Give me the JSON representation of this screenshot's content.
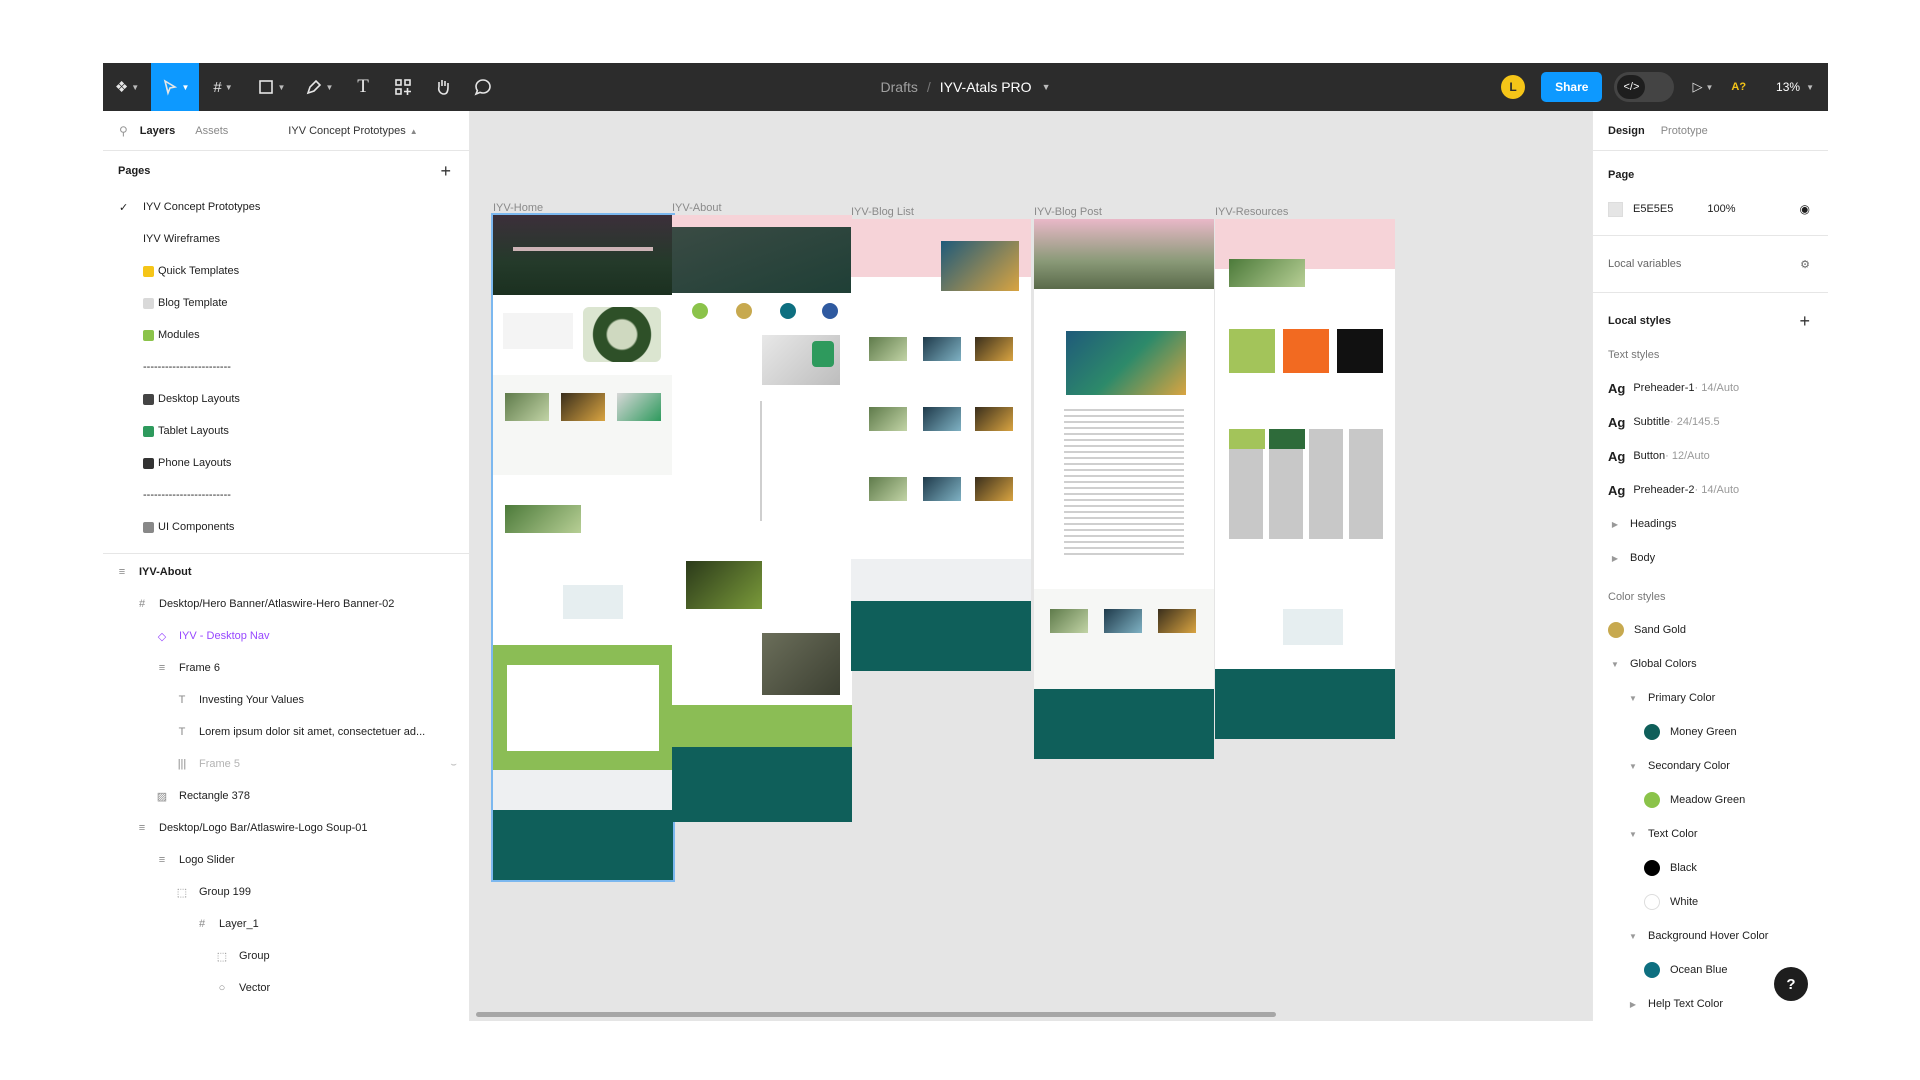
{
  "toolbar": {
    "breadcrumb_drafts": "Drafts",
    "breadcrumb_sep": "/",
    "file_name": "IYV-Atals PRO",
    "avatar_letter": "L",
    "share_label": "Share",
    "dev_mode_label": "</>",
    "ai_badge": "A?",
    "zoom": "13%"
  },
  "left_panel": {
    "tabs": [
      "Layers",
      "Assets"
    ],
    "page_picker": "IYV Concept Prototypes",
    "pages_heading": "Pages",
    "pages": [
      {
        "label": "IYV Concept Prototypes",
        "current": true,
        "icon": "check"
      },
      {
        "label": "IYV Wireframes",
        "icon": ""
      },
      {
        "label": "Quick Templates",
        "icon": "lightning"
      },
      {
        "label": "Blog Template",
        "icon": "page"
      },
      {
        "label": "Modules",
        "icon": "green-square"
      },
      {
        "label": "------------------------",
        "icon": ""
      },
      {
        "label": "Desktop Layouts",
        "icon": "monitor"
      },
      {
        "label": "Tablet Layouts",
        "icon": "tablet"
      },
      {
        "label": "Phone Layouts",
        "icon": "phone"
      },
      {
        "label": "------------------------",
        "icon": ""
      },
      {
        "label": "UI Components",
        "icon": "gear"
      }
    ],
    "layers": [
      {
        "label": "IYV-About",
        "icon": "≡",
        "indent": 0,
        "style": "bold"
      },
      {
        "label": "Desktop/Hero Banner/Atlaswire-Hero Banner-02",
        "icon": "#",
        "indent": 1,
        "style": ""
      },
      {
        "label": "IYV - Desktop Nav",
        "icon": "◇",
        "indent": 2,
        "style": "purple"
      },
      {
        "label": "Frame 6",
        "icon": "≡",
        "indent": 2,
        "style": ""
      },
      {
        "label": "Investing Your Values",
        "icon": "T",
        "indent": 3,
        "style": ""
      },
      {
        "label": "Lorem ipsum dolor sit amet, consectetuer ad...",
        "icon": "T",
        "indent": 3,
        "style": ""
      },
      {
        "label": "Frame 5",
        "icon": "|||",
        "indent": 3,
        "style": "dim"
      },
      {
        "label": "Rectangle 378",
        "icon": "▨",
        "indent": 2,
        "style": ""
      },
      {
        "label": "Desktop/Logo Bar/Atlaswire-Logo Soup-01",
        "icon": "≡",
        "indent": 1,
        "style": ""
      },
      {
        "label": "Logo Slider",
        "icon": "≡",
        "indent": 2,
        "style": ""
      },
      {
        "label": "Group 199",
        "icon": "⬚",
        "indent": 3,
        "style": ""
      },
      {
        "label": "Layer_1",
        "icon": "#",
        "indent": 4,
        "style": ""
      },
      {
        "label": "Group",
        "icon": "⬚",
        "indent": 5,
        "style": ""
      },
      {
        "label": "Vector",
        "icon": "○",
        "indent": 5,
        "style": ""
      }
    ]
  },
  "canvas": {
    "frames": [
      {
        "label": "IYV-Home",
        "selected": true
      },
      {
        "label": "IYV-About",
        "selected": false
      },
      {
        "label": "IYV-Blog List",
        "selected": false
      },
      {
        "label": "IYV-Blog Post",
        "selected": false
      },
      {
        "label": "IYV-Resources",
        "selected": false
      }
    ],
    "background": "#e5e5e5"
  },
  "right_panel": {
    "tabs": [
      "Design",
      "Prototype"
    ],
    "page_heading": "Page",
    "page_color": "E5E5E5",
    "page_opacity": "100%",
    "local_variables": "Local variables",
    "local_styles": "Local styles",
    "text_styles_heading": "Text styles",
    "text_styles": [
      {
        "name": "Preheader-1",
        "meta": " · 14/Auto"
      },
      {
        "name": "Subtitle",
        "meta": " · 24/145.5"
      },
      {
        "name": "Button",
        "meta": " · 12/Auto"
      },
      {
        "name": "Preheader-2",
        "meta": " · 14/Auto"
      }
    ],
    "text_groups": [
      "Headings",
      "Body"
    ],
    "color_styles_heading": "Color styles",
    "color_tree": [
      {
        "label": "Sand Gold",
        "type": "color",
        "color": "#c7a94f",
        "indent": 0
      },
      {
        "label": "Global Colors",
        "type": "group",
        "indent": 0
      },
      {
        "label": "Primary Color",
        "type": "group",
        "indent": 1
      },
      {
        "label": "Money Green",
        "type": "color",
        "color": "#0f5f5a",
        "indent": 2
      },
      {
        "label": "Secondary Color",
        "type": "group",
        "indent": 1
      },
      {
        "label": "Meadow Green",
        "type": "color",
        "color": "#8bc34a",
        "indent": 2
      },
      {
        "label": "Text Color",
        "type": "group",
        "indent": 1
      },
      {
        "label": "Black",
        "type": "color",
        "color": "#000000",
        "indent": 2
      },
      {
        "label": "White",
        "type": "color",
        "color": "#ffffff",
        "indent": 2
      },
      {
        "label": "Background Hover Color",
        "type": "group",
        "indent": 1
      },
      {
        "label": "Ocean Blue",
        "type": "color",
        "color": "#0e6f80",
        "indent": 2
      },
      {
        "label": "Help Text Color",
        "type": "group-collapsed",
        "indent": 1
      }
    ],
    "help_label": "?"
  },
  "colors": {
    "figma_blue": "#0d99ff",
    "toolbar_bg": "#2c2c2c",
    "selection": "#7cb8ef",
    "brand_teal": "#0f5f5a",
    "brand_green": "#8bc34a",
    "brand_pink": "#f6d3d8"
  }
}
